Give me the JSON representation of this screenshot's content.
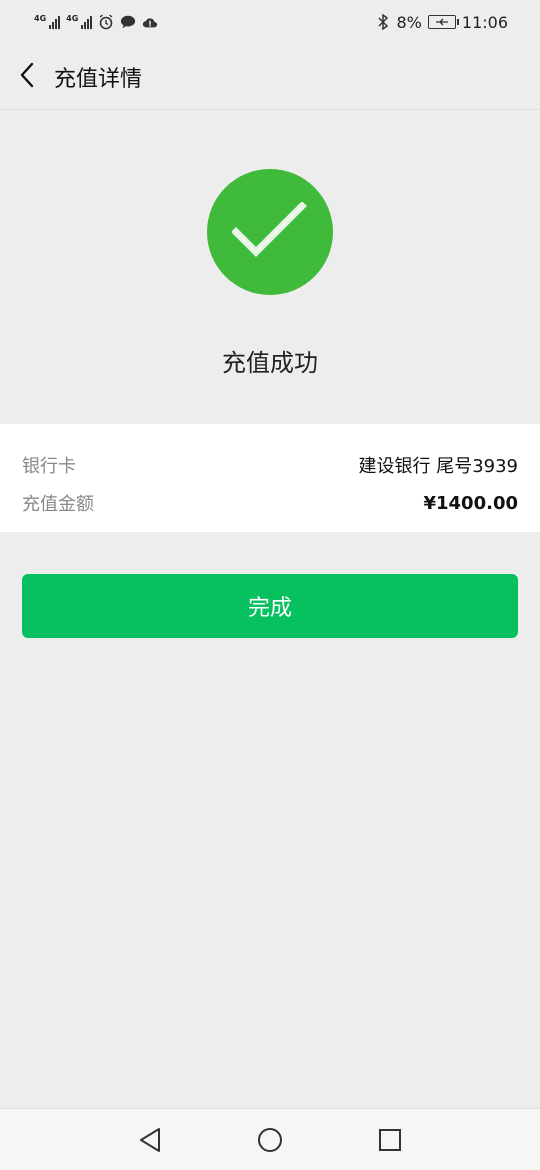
{
  "status_bar": {
    "network_1": "4G",
    "network_2": "4G",
    "battery_percent": "8%",
    "time": "11:06",
    "icons": [
      "signal-icon",
      "signal-icon",
      "alarm-icon",
      "chat-icon",
      "cloud-icon",
      "bluetooth-icon",
      "battery-icon"
    ]
  },
  "header": {
    "title": "充值详情"
  },
  "result": {
    "status_text": "充值成功",
    "icon": "success-check-icon",
    "accent_color": "#3fba3a"
  },
  "details": {
    "rows": [
      {
        "label": "银行卡",
        "value": "建设银行 尾号3939"
      },
      {
        "label": "充值金额",
        "value": "¥1400.00"
      }
    ]
  },
  "actions": {
    "done_label": "完成",
    "done_color": "#07c160"
  },
  "system_nav": {
    "icons": [
      "back-triangle-icon",
      "home-circle-icon",
      "recent-square-icon"
    ]
  }
}
